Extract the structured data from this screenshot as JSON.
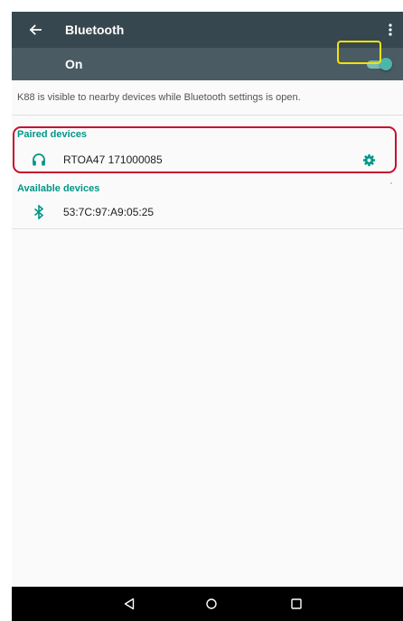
{
  "app_bar": {
    "title": "Bluetooth",
    "back_icon": "arrow-back-icon",
    "more_icon": "more-vert-icon",
    "background": "#37474f"
  },
  "master_switch": {
    "label": "On",
    "state": "on",
    "background": "#4a5b63",
    "accent": "#4db6ac"
  },
  "visibility_notice": "K88 is visible to nearby devices while Bluetooth settings is open.",
  "paired_devices": {
    "header": "Paired devices",
    "items": [
      {
        "name": "RTOA47 171000085",
        "icon": "headphones-icon",
        "action_icon": "gear-icon"
      }
    ]
  },
  "available_devices": {
    "header": "Available devices",
    "items": [
      {
        "name": "53:7C:97:A9:05:25",
        "icon": "bluetooth-icon"
      }
    ]
  },
  "annotations": {
    "yellow_box_color": "#f5e300",
    "red_box_color": "#c8102e"
  },
  "nav_bar": {
    "back_icon": "nav-back-triangle-icon",
    "home_icon": "nav-home-circle-icon",
    "recents_icon": "nav-recents-square-icon"
  },
  "colors": {
    "section_header": "#009688",
    "text_primary": "#212121",
    "text_secondary": "#545454"
  }
}
